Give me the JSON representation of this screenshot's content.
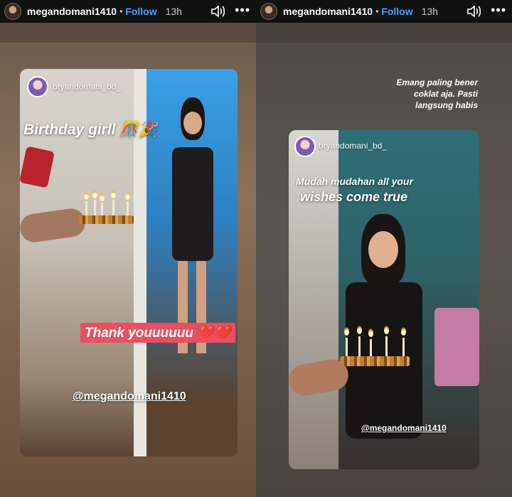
{
  "left": {
    "header": {
      "username": "megandomani1410",
      "dot": "•",
      "follow": "Follow",
      "time": "13h",
      "more": "•••"
    },
    "story": {
      "username": "bryandomani_bd_",
      "caption": "Birthday girll",
      "caption_emoji": "🎊🎉",
      "thanks": "Thank youuuuuu",
      "thanks_emoji": "❤️❤️",
      "mention": "@megandomani1410"
    }
  },
  "right": {
    "header": {
      "username": "megandomani1410",
      "dot": "•",
      "follow": "Follow",
      "time": "13h",
      "more": "•••"
    },
    "outer_caption": [
      "Emang paling bener",
      "coklat aja. Pasti",
      "langsung habis"
    ],
    "story": {
      "username": "bryandomani_bd_",
      "caption_line1": "Mudah mudahan all your",
      "caption_line2": "wishes come true",
      "mention": "@megandomani1410"
    }
  },
  "colors": {
    "follow": "#4aa3ff",
    "thanks_bg": "#e94f5f"
  },
  "icons": {
    "sound": "speaker-wave-icon",
    "more": "more-dots-icon"
  }
}
